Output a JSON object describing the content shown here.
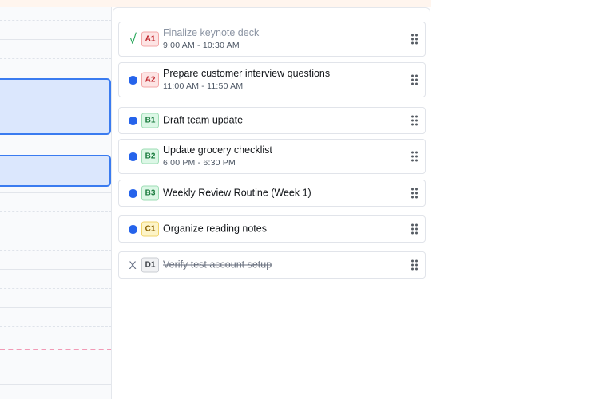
{
  "tasks": [
    {
      "status": "done",
      "code": "A1",
      "color": "red",
      "title": "Finalize keynote deck",
      "time": "9:00 AM - 10:30 AM"
    },
    {
      "status": "open",
      "code": "A2",
      "color": "red",
      "title": "Prepare customer interview questions",
      "time": "11:00 AM - 11:50 AM"
    },
    {
      "status": "open",
      "code": "B1",
      "color": "green",
      "title": "Draft team update",
      "time": ""
    },
    {
      "status": "open",
      "code": "B2",
      "color": "green",
      "title": "Update grocery checklist",
      "time": "6:00 PM - 6:30 PM"
    },
    {
      "status": "open",
      "code": "B3",
      "color": "green",
      "title": "Weekly Review Routine (Week 1)",
      "time": ""
    },
    {
      "status": "open",
      "code": "C1",
      "color": "yellow",
      "title": "Organize reading notes",
      "time": ""
    },
    {
      "status": "cancelled",
      "code": "D1",
      "color": "gray",
      "title": "Verify test account setup",
      "time": ""
    }
  ],
  "status_symbols": {
    "done": "√",
    "cancelled": "X"
  },
  "icons": {
    "drag": "drag-handle-icon",
    "done": "check-icon",
    "open": "status-dot-icon",
    "cancelled": "cancel-x-icon"
  },
  "colors": {
    "accent": "#2563eb",
    "done": "#20a455",
    "event_fill": "#dbe7fd",
    "event_border": "#3a7bf0",
    "now_line": "#f29ab6"
  }
}
